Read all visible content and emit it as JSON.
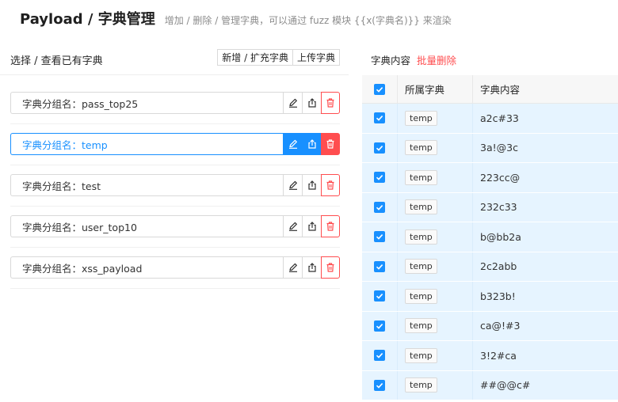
{
  "header": {
    "title": "Payload / 字典管理",
    "description": "增加 / 删除 / 管理字典，可以通过 fuzz 模块 {{x(字典名)}} 来渲染"
  },
  "left_panel": {
    "title": "选择 / 查看已有字典",
    "add_button": "新增 / 扩充字典",
    "upload_button": "上传字典",
    "groups": [
      {
        "label": "字典分组名：pass_top25",
        "active": false
      },
      {
        "label": "字典分组名：temp",
        "active": true
      },
      {
        "label": "字典分组名：test",
        "active": false
      },
      {
        "label": "字典分组名：user_top10",
        "active": false
      },
      {
        "label": "字典分组名：xss_payload",
        "active": false
      }
    ]
  },
  "right_panel": {
    "title": "字典内容",
    "batch_delete": "批量删除",
    "columns": [
      "所属字典",
      "字典内容"
    ],
    "rows": [
      {
        "dict": "temp",
        "content": "a2c#33",
        "checked": true
      },
      {
        "dict": "temp",
        "content": "3a!@3c",
        "checked": true
      },
      {
        "dict": "temp",
        "content": "223cc@",
        "checked": true
      },
      {
        "dict": "temp",
        "content": "232c33",
        "checked": true
      },
      {
        "dict": "temp",
        "content": "b@bb2a",
        "checked": true
      },
      {
        "dict": "temp",
        "content": "2c2abb",
        "checked": true
      },
      {
        "dict": "temp",
        "content": "b323b!",
        "checked": true
      },
      {
        "dict": "temp",
        "content": "ca@!#3",
        "checked": true
      },
      {
        "dict": "temp",
        "content": "3!2#ca",
        "checked": true
      },
      {
        "dict": "temp",
        "content": "##@@c#",
        "checked": true
      }
    ]
  },
  "icons": {
    "edit": "pencil-icon",
    "export": "export-icon",
    "delete": "trash-icon",
    "check": "check-icon"
  },
  "colors": {
    "primary": "#1890ff",
    "danger": "#ff4d4f",
    "row_selected_bg": "#e6f4ff"
  }
}
